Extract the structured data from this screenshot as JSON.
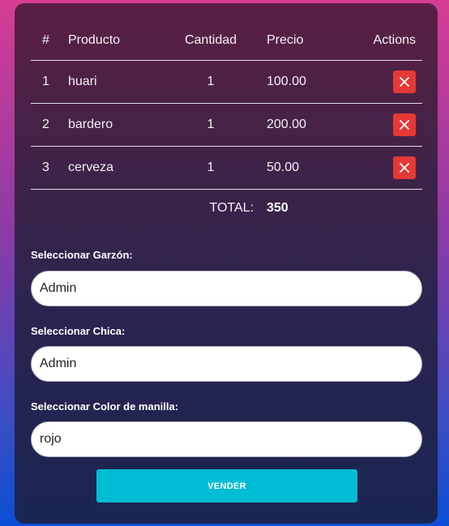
{
  "table": {
    "headers": {
      "num": "#",
      "product": "Producto",
      "quantity": "Cantidad",
      "price": "Precio",
      "actions": "Actions"
    },
    "rows": [
      {
        "num": "1",
        "product": "huari",
        "quantity": "1",
        "price": "100.00"
      },
      {
        "num": "2",
        "product": "bardero",
        "quantity": "1",
        "price": "200.00"
      },
      {
        "num": "3",
        "product": "cerveza",
        "quantity": "1",
        "price": "50.00"
      }
    ],
    "delete_icon": "close-icon",
    "total_label": "TOTAL:",
    "total_value": "350"
  },
  "form": {
    "garzon": {
      "label": "Seleccionar Garzón:",
      "value": "Admin"
    },
    "chica": {
      "label": "Seleccionar Chica:",
      "value": "Admin"
    },
    "manilla": {
      "label": "Seleccionar Color de manilla:",
      "value": "rojo"
    },
    "submit_label": "VENDER"
  },
  "colors": {
    "delete_button": "#e53935",
    "submit_button": "#00bcd4"
  }
}
